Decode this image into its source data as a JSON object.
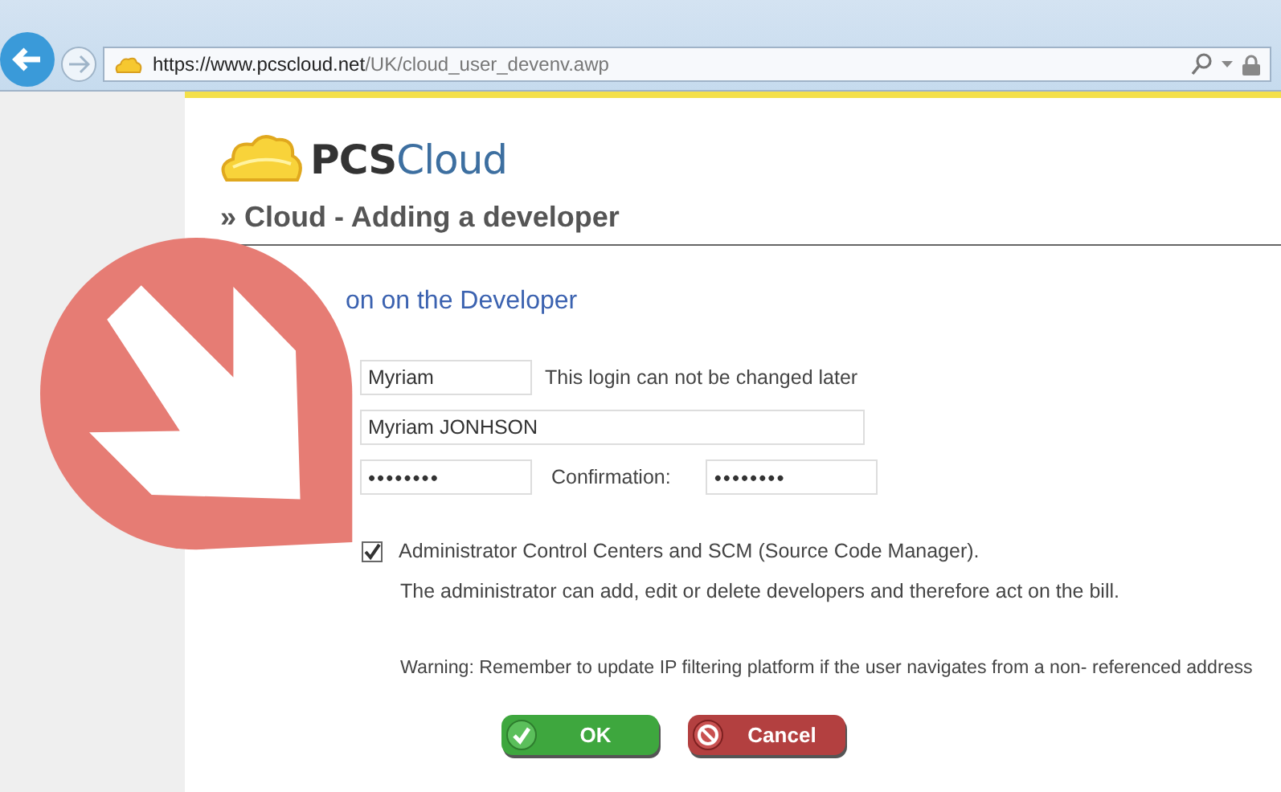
{
  "browser": {
    "url_host": "https://www.pcscloud.net",
    "url_path": "/UK/cloud_user_devenv.awp"
  },
  "logo": {
    "part_1": "PCS",
    "part_2": "Cloud"
  },
  "page_title": "» Cloud - Adding a developer",
  "section_title": "on on the Developer",
  "fields": [
    {
      "kind": "text",
      "value": "Myriam",
      "hint": "This login can not be changed later",
      "wide": false
    },
    {
      "kind": "text",
      "value": "Myriam JONHSON",
      "wide": true
    },
    {
      "kind": "password",
      "value": "••••••••",
      "confirm_label": "Confirmation:",
      "confirm_value": "••••••••",
      "wide": false
    }
  ],
  "admin": {
    "checked": true,
    "label": "Administrator Control Centers and SCM (Source Code Manager).",
    "description": "The administrator can add, edit or delete developers and therefore act on the bill.",
    "warning": "Warning: Remember to update IP filtering platform if the user navigates from a non- referenced address"
  },
  "buttons": [
    {
      "kind": "ok",
      "label": "OK"
    },
    {
      "kind": "cancel",
      "label": "Cancel"
    }
  ]
}
